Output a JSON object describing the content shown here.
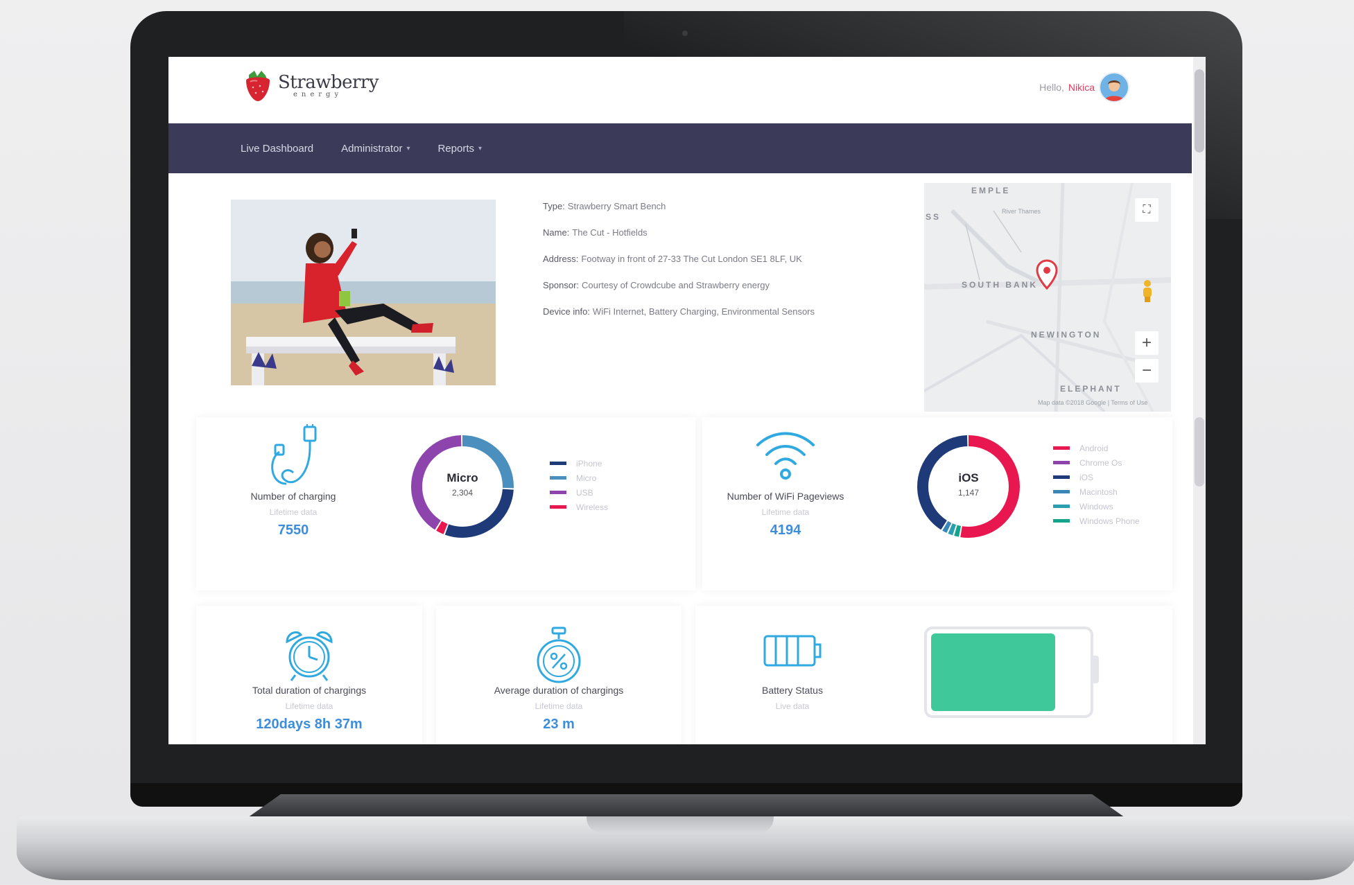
{
  "header": {
    "logo_name": "Strawberry",
    "logo_sub": "energy",
    "greeting": "Hello,",
    "user_name": "Nikica"
  },
  "nav": {
    "items": [
      {
        "label": "Live Dashboard",
        "has_caret": false
      },
      {
        "label": "Administrator",
        "has_caret": true
      },
      {
        "label": "Reports",
        "has_caret": true
      }
    ]
  },
  "device": {
    "rows": [
      {
        "key": "Type:",
        "value": "Strawberry Smart Bench"
      },
      {
        "key": "Name:",
        "value": "The Cut - Hotfields"
      },
      {
        "key": "Address:",
        "value": "Footway in front of 27-33 The Cut London SE1 8LF, UK"
      },
      {
        "key": "Sponsor:",
        "value": "Courtesy of Crowdcube and Strawberry energy"
      },
      {
        "key": "Device info:",
        "value": "WiFi Internet, Battery Charging, Environmental Sensors"
      }
    ]
  },
  "map": {
    "labels": [
      "SOUTH BANK",
      "NEWINGTON",
      "ELEPHANT",
      "EMPLE",
      "SS"
    ],
    "small_labels": [
      "River Thames",
      "Map data ©2018 Google | Terms of Use"
    ],
    "fullscreen_icon": "fullscreen-icon",
    "zoom_in": "+",
    "zoom_out": "−"
  },
  "charging": {
    "title": "Number of charging",
    "subtitle": "Lifetime data",
    "value": "7550",
    "donut_title": "Micro",
    "donut_value": "2,304",
    "legend": [
      {
        "label": "iPhone",
        "color": "#1e3a78"
      },
      {
        "label": "Micro",
        "color": "#4b8fbf"
      },
      {
        "label": "USB",
        "color": "#8e44ad"
      },
      {
        "label": "Wireless",
        "color": "#e8174f"
      }
    ],
    "segments": [
      {
        "label": "Micro",
        "fraction": 0.26,
        "color": "#4b8fbf"
      },
      {
        "label": "iPhone",
        "fraction": 0.3,
        "color": "#1e3a78"
      },
      {
        "label": "Wireless",
        "fraction": 0.03,
        "color": "#e8174f"
      },
      {
        "label": "USB",
        "fraction": 0.41,
        "color": "#8e44ad"
      }
    ]
  },
  "wifi": {
    "title": "Number of WiFi Pageviews",
    "subtitle": "Lifetime data",
    "value": "4194",
    "donut_title": "iOS",
    "donut_value": "1,147",
    "legend": [
      {
        "label": "Android",
        "color": "#e8174f"
      },
      {
        "label": "Chrome Os",
        "color": "#8e44ad"
      },
      {
        "label": "iOS",
        "color": "#1e3a78"
      },
      {
        "label": "Macintosh",
        "color": "#3a86b8"
      },
      {
        "label": "Windows",
        "color": "#2b9fb0"
      },
      {
        "label": "Windows Phone",
        "color": "#14a38b"
      }
    ],
    "segments": [
      {
        "label": "Android",
        "fraction": 0.53,
        "color": "#e8174f"
      },
      {
        "label": "Windows Phone",
        "fraction": 0.02,
        "color": "#14a38b"
      },
      {
        "label": "Windows",
        "fraction": 0.02,
        "color": "#2b9fb0"
      },
      {
        "label": "Macintosh",
        "fraction": 0.02,
        "color": "#3a86b8"
      },
      {
        "label": "iOS",
        "fraction": 0.41,
        "color": "#1e3a78"
      }
    ]
  },
  "total_duration": {
    "title": "Total duration of chargings",
    "subtitle": "Lifetime data",
    "value": "120days 8h 37m"
  },
  "average_duration": {
    "title": "Average duration of chargings",
    "subtitle": "Lifetime data",
    "value": "23 m"
  },
  "battery": {
    "title": "Battery Status",
    "subtitle": "Live data",
    "level": 0.8,
    "color": "#3fc99b"
  }
}
